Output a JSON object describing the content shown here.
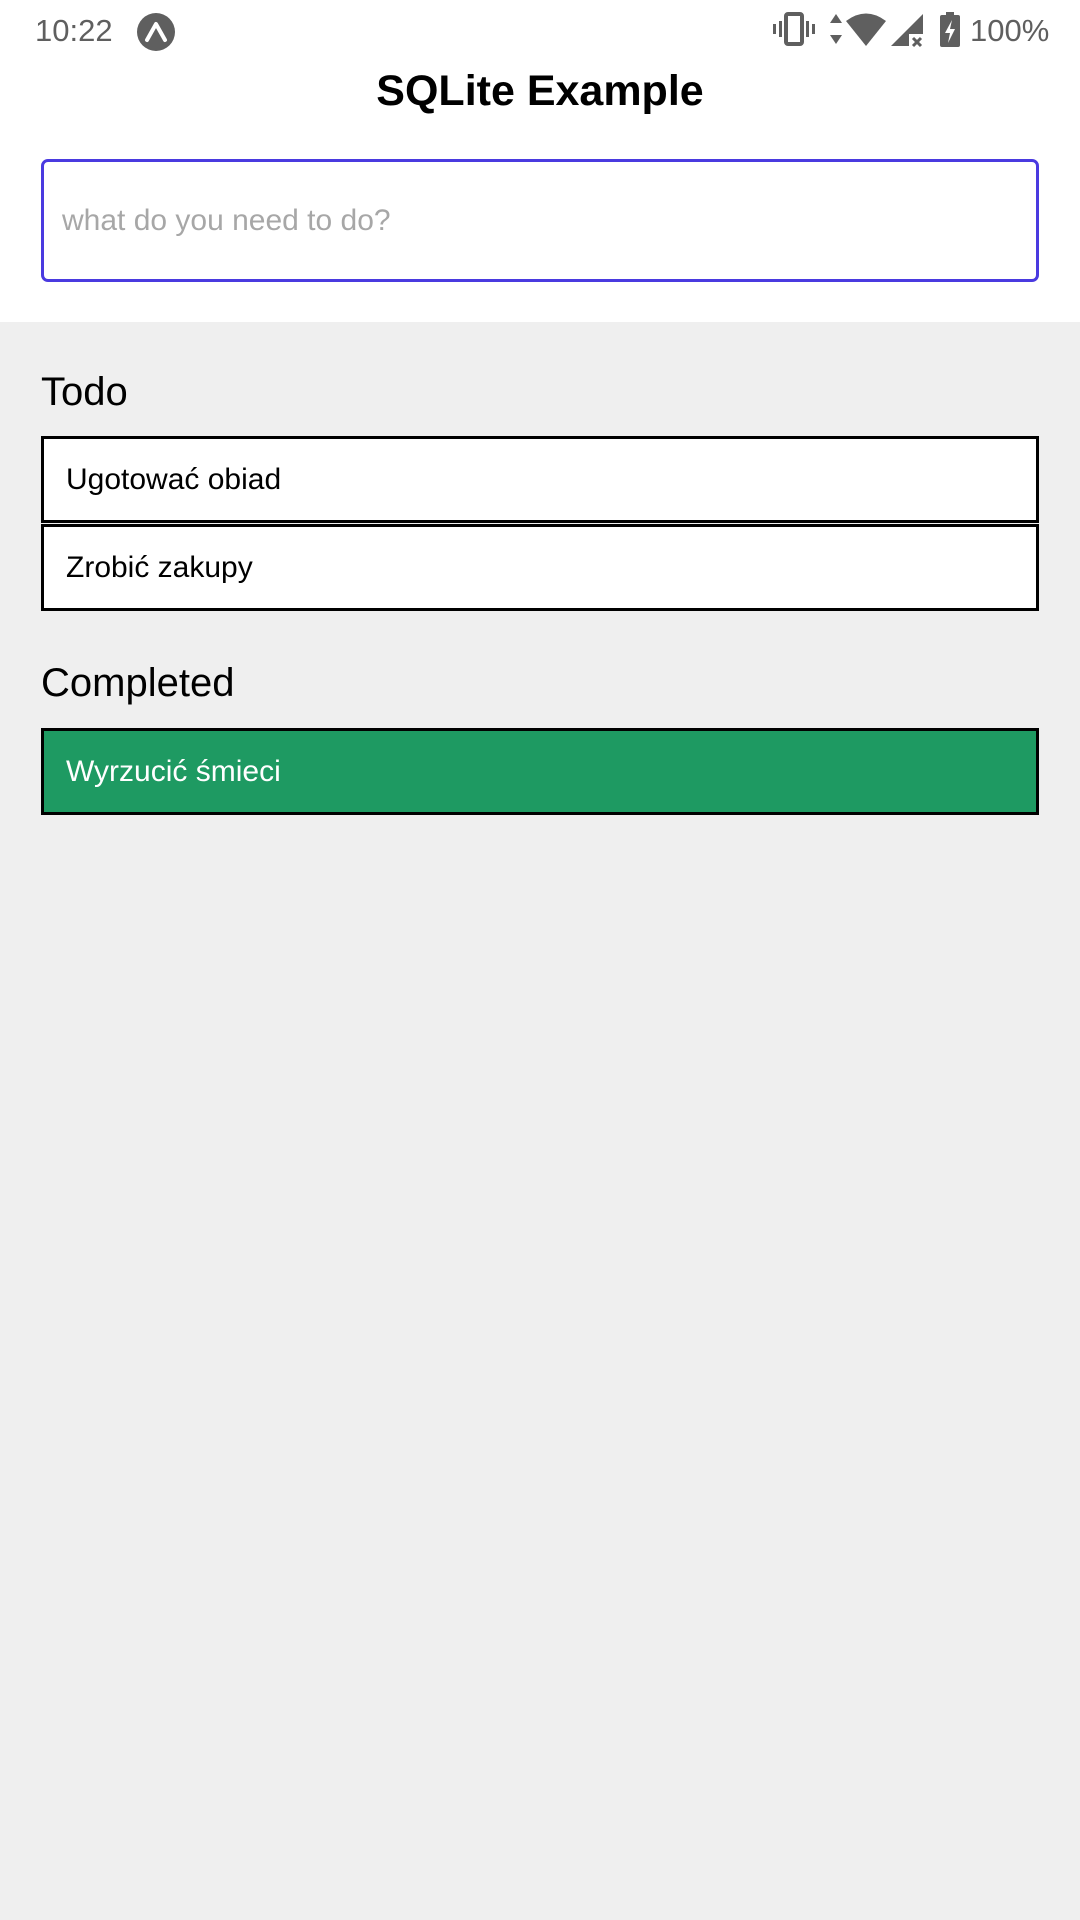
{
  "status_bar": {
    "time": "10:22",
    "battery": "100%",
    "icons": [
      "expo-icon",
      "vibrate-icon",
      "data-arrows-icon",
      "wifi-icon",
      "cell-signal-off-icon",
      "battery-charging-icon"
    ]
  },
  "header": {
    "title": "SQLite Example"
  },
  "input": {
    "placeholder": "what do you need to do?",
    "value": "",
    "border_color": "#4a3ae0"
  },
  "sections": {
    "todo": {
      "heading": "Todo",
      "items": [
        {
          "label": "Ugotować obiad"
        },
        {
          "label": "Zrobić zakupy"
        }
      ]
    },
    "completed": {
      "heading": "Completed",
      "items": [
        {
          "label": "Wyrzucić śmieci"
        }
      ],
      "item_color": "#1e9a62"
    }
  },
  "colors": {
    "background": "#efefef",
    "surface": "#ffffff",
    "text": "#000000"
  }
}
